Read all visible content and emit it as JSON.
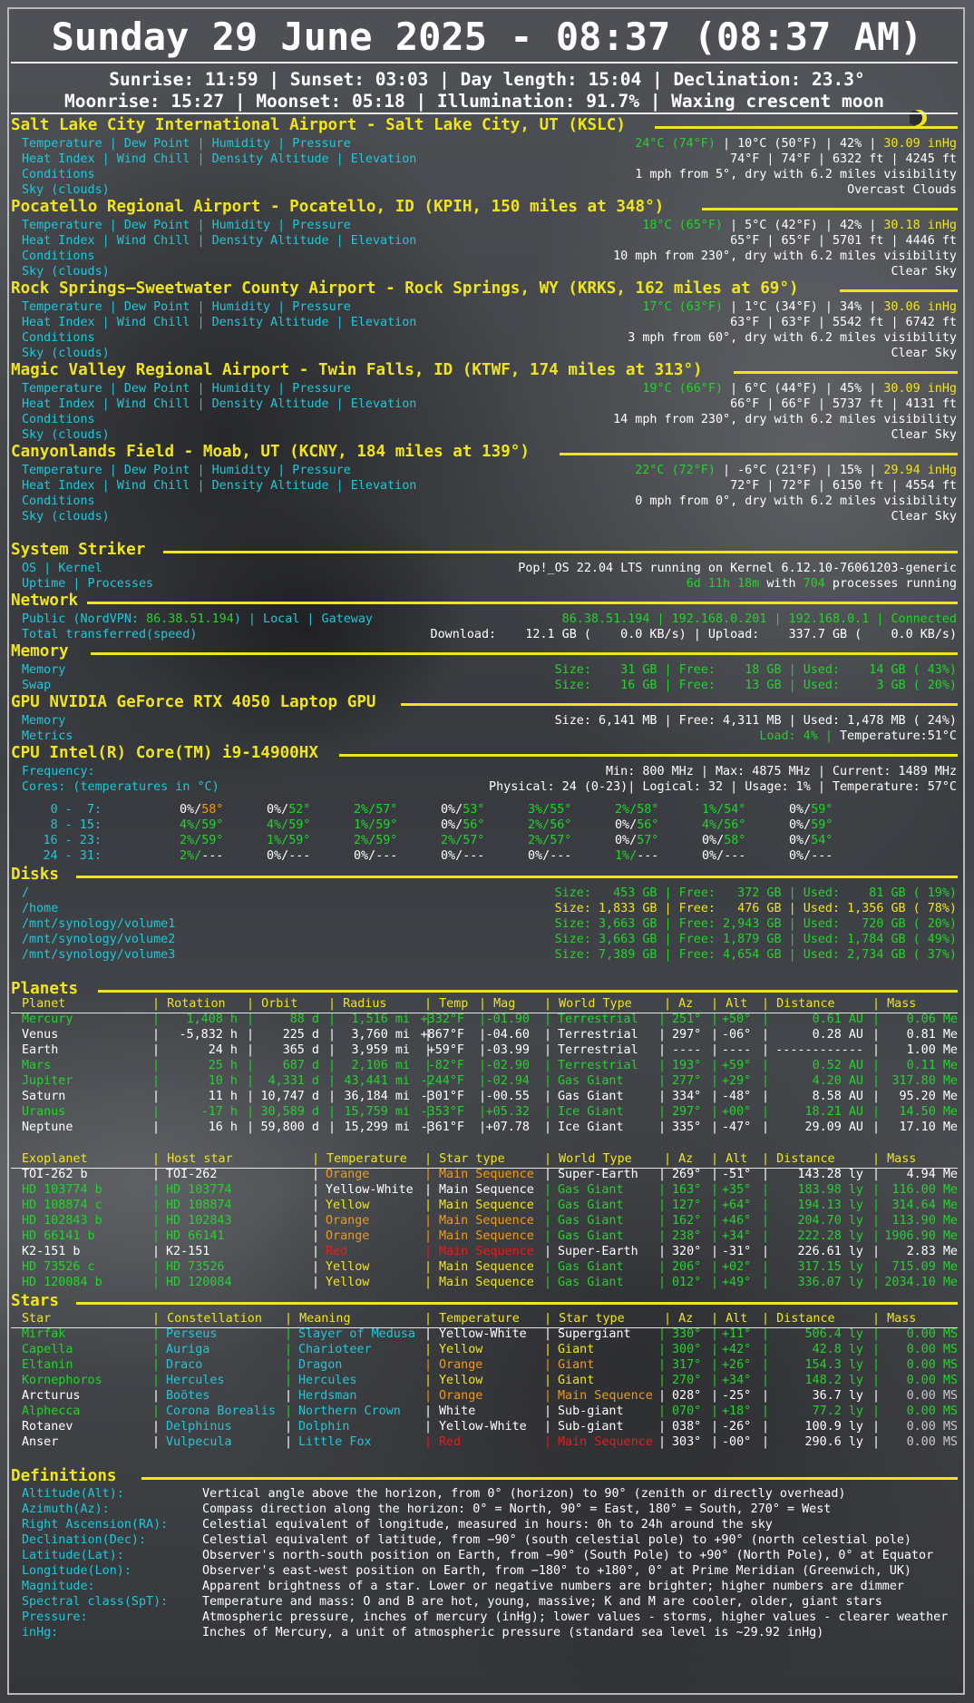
{
  "header": {
    "title": "Sunday 29 June 2025 - 08:37 (08:37 AM)",
    "sun_line": "Sunrise: 11:59 | Sunset: 03:03 | Day length: 15:04 | Declination: 23.3°",
    "moon_line": "Moonrise: 15:27 | Moonset: 05:18 | Illumination: 91.7% | Waxing crescent moon"
  },
  "labels": {
    "weather_row1": "Temperature | Dew Point | Humidity | Pressure",
    "weather_row2": "Heat Index | Wind Chill | Density Altitude | Elevation",
    "weather_row3": "Conditions",
    "weather_row4": "Sky (clouds)"
  },
  "stations": [
    {
      "title": "Salt Lake City International Airport - Salt Lake City, UT (KSLC)",
      "temp": "24°C (74°F)",
      "mid": " | 10°C (50°F) | 42% | ",
      "pressure": "30.09 inHg",
      "row2": "74°F | 74°F | 6322 ft | 4245 ft",
      "row3": "1 mph from 5°, dry with 6.2 miles visibility",
      "row4": "Overcast Clouds"
    },
    {
      "title": "Pocatello Regional Airport - Pocatello, ID (KPIH, 150 miles at 348°)",
      "temp": "18°C (65°F)",
      "mid": " | 5°C (42°F) | 42% | ",
      "pressure": "30.18 inHg",
      "row2": "65°F | 65°F | 5701 ft | 4446 ft",
      "row3": "10 mph from 230°, dry with 6.2 miles visibility",
      "row4": "Clear Sky"
    },
    {
      "title": "Rock Springs–Sweetwater County Airport - Rock Springs, WY (KRKS, 162 miles at 69°)",
      "temp": "17°C (63°F)",
      "mid": " | 1°C (34°F) | 34% | ",
      "pressure": "30.06 inHg",
      "row2": "63°F | 63°F | 5542 ft | 6742 ft",
      "row3": "3 mph from 60°, dry with 6.2 miles visibility",
      "row4": "Clear Sky"
    },
    {
      "title": "Magic Valley Regional Airport - Twin Falls, ID (KTWF, 174 miles at 313°)",
      "temp": "19°C (66°F)",
      "mid": " | 6°C (44°F) | 45% | ",
      "pressure": "30.09 inHg",
      "row2": "66°F | 66°F | 5737 ft | 4131 ft",
      "row3": "14 mph from 230°, dry with 6.2 miles visibility",
      "row4": "Clear Sky"
    },
    {
      "title": "Canyonlands Field - Moab, UT (KCNY, 184 miles at 139°)",
      "temp": "22°C (72°F)",
      "mid": " | -6°C (21°F) | 15% | ",
      "pressure": "29.94 inHg",
      "row2": "72°F | 72°F | 6150 ft | 4554 ft",
      "row3": "0 mph from 0°, dry with 6.2 miles visibility",
      "row4": "Clear Sky"
    }
  ],
  "system": {
    "title": "System Striker",
    "os_label": "OS | Kernel",
    "os_value": "Pop!_OS 22.04 LTS running on Kernel 6.12.10-76061203-generic",
    "uptime_label": "Uptime | Processes",
    "uptime_value": "6d 11h 18m",
    "uptime_mid": " with ",
    "processes": "704",
    "processes_suffix": " processes running"
  },
  "network": {
    "title": "Network",
    "public_label_a": "Public (NordVPN: ",
    "public_ip": "86.38.51.194",
    "public_label_b": ") | Local | Gateway",
    "public_value": "86.38.51.194 | 192.168.0.201 | 192.168.0.1 | Connected",
    "total_label": "Total transferred(speed)",
    "total_value": "Download:    12.1 GB (    0.0 KB/s) | Upload:    337.7 GB (    0.0 KB/s)"
  },
  "memory": {
    "title": "Memory",
    "mem_label": "Memory",
    "mem_value": "Size:    31 GB | Free:    18 GB | Used:    14 GB ( 43%)",
    "swap_label": "Swap",
    "swap_value": "Size:    16 GB | Free:    13 GB | Used:     3 GB ( 20%)"
  },
  "gpu": {
    "title": "GPU NVIDIA GeForce RTX 4050 Laptop GPU",
    "mem_label": "Memory",
    "mem_value": "Size: 6,141 MB | Free: 4,311 MB | Used: 1,478 MB ( 24%)",
    "metrics_label": "Metrics",
    "load": "Load: 4%",
    "load_sep": " | ",
    "temperature": "Temperature:51°C"
  },
  "cpu": {
    "title": "CPU Intel(R) Core(TM) i9-14900HX",
    "freq_label": "Frequency:",
    "freq_value": "Min: 800 MHz | Max: 4875 MHz | Current: 1489 MHz",
    "cores_label": "Cores: (temperatures in °C)",
    "cores_value": "Physical: 24 (0-23)| Logical: 32 | Usage: 1% | Temperature: 57°C",
    "rows": [
      {
        "label": "0 -  7:",
        "cells": [
          [
            "0%/",
            "58°",
            "w",
            "o"
          ],
          [
            "0%/",
            "52°",
            "w",
            "g"
          ],
          [
            "2%/",
            "57°",
            "g",
            "g"
          ],
          [
            "0%/",
            "53°",
            "w",
            "g"
          ],
          [
            "3%/",
            "55°",
            "g",
            "g"
          ],
          [
            "2%/",
            "58°",
            "g",
            "g"
          ],
          [
            "1%/",
            "54°",
            "g",
            "g"
          ],
          [
            "0%/",
            "59°",
            "w",
            "g"
          ]
        ]
      },
      {
        "label": "8 - 15:",
        "cells": [
          [
            "4%/",
            "59°",
            "g",
            "g"
          ],
          [
            "4%/",
            "59°",
            "g",
            "g"
          ],
          [
            "1%/",
            "59°",
            "g",
            "g"
          ],
          [
            "0%/",
            "56°",
            "w",
            "g"
          ],
          [
            "2%/",
            "56°",
            "g",
            "g"
          ],
          [
            "0%/",
            "56°",
            "w",
            "g"
          ],
          [
            "4%/",
            "56°",
            "g",
            "g"
          ],
          [
            "0%/",
            "59°",
            "w",
            "g"
          ]
        ]
      },
      {
        "label": "16 - 23:",
        "cells": [
          [
            "2%/",
            "59°",
            "g",
            "g"
          ],
          [
            "1%/",
            "59°",
            "g",
            "g"
          ],
          [
            "2%/",
            "59°",
            "g",
            "g"
          ],
          [
            "2%/",
            "57°",
            "g",
            "g"
          ],
          [
            "2%/",
            "57°",
            "g",
            "g"
          ],
          [
            "0%/",
            "57°",
            "w",
            "g"
          ],
          [
            "0%/",
            "58°",
            "w",
            "g"
          ],
          [
            "0%/",
            "54°",
            "w",
            "g"
          ]
        ]
      },
      {
        "label": "24 - 31:",
        "cells": [
          [
            "2%/",
            "---",
            "g",
            "w"
          ],
          [
            "0%/",
            "---",
            "w",
            "w"
          ],
          [
            "0%/",
            "---",
            "w",
            "w"
          ],
          [
            "0%/",
            "---",
            "w",
            "w"
          ],
          [
            "0%/",
            "---",
            "w",
            "w"
          ],
          [
            "1%/",
            "---",
            "g",
            "w"
          ],
          [
            "0%/",
            "---",
            "w",
            "w"
          ],
          [
            "0%/",
            "---",
            "w",
            "w"
          ]
        ]
      }
    ]
  },
  "disks": {
    "title": "Disks",
    "items": [
      {
        "mount": "/",
        "value": "Size:   453 GB | Free:   372 GB | Used:    81 GB ( 19%)",
        "cls": "g"
      },
      {
        "mount": "/home",
        "value": "Size: 1,833 GB | Free:   476 GB | Used: 1,356 GB ( 78%)",
        "cls": "y"
      },
      {
        "mount": "/mnt/synology/volume1",
        "value": "Size: 3,663 GB | Free: 2,943 GB | Used:   720 GB ( 20%)",
        "cls": "g"
      },
      {
        "mount": "/mnt/synology/volume2",
        "value": "Size: 3,663 GB | Free: 1,879 GB | Used: 1,784 GB ( 49%)",
        "cls": "g"
      },
      {
        "mount": "/mnt/synology/volume3",
        "value": "Size: 7,389 GB | Free: 4,654 GB | Used: 2,734 GB ( 37%)",
        "cls": "g"
      }
    ]
  },
  "planets": {
    "title": "Planets",
    "headers": [
      "Planet",
      "| Rotation",
      "| Orbit",
      "| Radius",
      "| Temp",
      "| Mag",
      "| World Type",
      "| Az",
      "| Alt",
      "| Distance",
      "| Mass"
    ],
    "rows": [
      {
        "c": "g",
        "name": "Mercury",
        "rot": "1,408 h",
        "orbit": "88 d",
        "radius": "1,516 mi",
        "temp": "+332°F",
        "mag": "-01.90",
        "type": "Terrestrial",
        "az": "251°",
        "alt": "+50°",
        "dist": "0.61 AU",
        "mass": "0.06 Me"
      },
      {
        "c": "w",
        "name": "Venus",
        "rot": "-5,832 h",
        "orbit": "225 d",
        "radius": "3,760 mi",
        "temp": "+867°F",
        "mag": "-04.60",
        "type": "Terrestrial",
        "az": "297°",
        "alt": "-06°",
        "dist": "0.28 AU",
        "mass": "0.81 Me"
      },
      {
        "c": "w",
        "name": "Earth",
        "rot": "24 h",
        "orbit": "365 d",
        "radius": "3,959 mi",
        "temp": "+59°F",
        "mag": "-03.99",
        "type": "Terrestrial",
        "az": "----",
        "alt": "----",
        "dist": "------------",
        "mass": "1.00 Me"
      },
      {
        "c": "g",
        "name": "Mars",
        "rot": "25 h",
        "orbit": "687 d",
        "radius": "2,106 mi",
        "temp": "-82°F",
        "mag": "-02.90",
        "type": "Terrestrial",
        "az": "193°",
        "alt": "+59°",
        "dist": "0.52 AU",
        "mass": "0.11 Me"
      },
      {
        "c": "g",
        "name": "Jupiter",
        "rot": "10 h",
        "orbit": "4,331 d",
        "radius": "43,441 mi",
        "temp": "-244°F",
        "mag": "-02.94",
        "type": "Gas Giant",
        "az": "277°",
        "alt": "+29°",
        "dist": "4.20 AU",
        "mass": "317.80 Me"
      },
      {
        "c": "w",
        "name": "Saturn",
        "rot": "11 h",
        "orbit": "10,747 d",
        "radius": "36,184 mi",
        "temp": "-301°F",
        "mag": "-00.55",
        "type": "Gas Giant",
        "az": "334°",
        "alt": "-48°",
        "dist": "8.58 AU",
        "mass": "95.20 Me"
      },
      {
        "c": "g",
        "name": "Uranus",
        "rot": "-17 h",
        "orbit": "30,589 d",
        "radius": "15,759 mi",
        "temp": "-353°F",
        "mag": "+05.32",
        "type": "Ice Giant",
        "az": "297°",
        "alt": "+00°",
        "dist": "18.21 AU",
        "mass": "14.50 Me"
      },
      {
        "c": "w",
        "name": "Neptune",
        "rot": "16 h",
        "orbit": "59,800 d",
        "radius": "15,299 mi",
        "temp": "-361°F",
        "mag": "+07.78",
        "type": "Ice Giant",
        "az": "335°",
        "alt": "-47°",
        "dist": "29.09 AU",
        "mass": "17.10 Me"
      }
    ]
  },
  "exoplanets": {
    "headers": [
      "Exoplanet",
      "| Host star",
      "| Temperature",
      "| Star type",
      "| World Type",
      "| Az",
      "| Alt",
      "| Distance",
      "| Mass"
    ],
    "rows": [
      {
        "c": "w",
        "name": "TOI-262 b",
        "host": "TOI-262",
        "temp": "Orange",
        "tc": "o",
        "stype": "Main Sequence",
        "sc": "o",
        "wtype": "Super-Earth",
        "az": "269°",
        "alt": "-51°",
        "dist": "143.28 ly",
        "mass": "4.94 Me"
      },
      {
        "c": "g",
        "name": "HD 103774 b",
        "host": "HD 103774",
        "temp": "Yellow-White",
        "tc": "w",
        "stype": "Main Sequence",
        "sc": "w",
        "wtype": "Gas Giant",
        "az": "163°",
        "alt": "+35°",
        "dist": "183.98 ly",
        "mass": "116.00 Me"
      },
      {
        "c": "g",
        "name": "HD 108874 c",
        "host": "HD 108874",
        "temp": "Yellow",
        "tc": "y",
        "stype": "Main Sequence",
        "sc": "y",
        "wtype": "Gas Giant",
        "az": "127°",
        "alt": "+64°",
        "dist": "194.13 ly",
        "mass": "314.64 Me"
      },
      {
        "c": "g",
        "name": "HD 102843 b",
        "host": "HD 102843",
        "temp": "Orange",
        "tc": "o",
        "stype": "Main Sequence",
        "sc": "o",
        "wtype": "Gas Giant",
        "az": "162°",
        "alt": "+46°",
        "dist": "204.70 ly",
        "mass": "113.90 Me"
      },
      {
        "c": "g",
        "name": "HD 66141 b",
        "host": "HD 66141",
        "temp": "Orange",
        "tc": "o",
        "stype": "Main Sequence",
        "sc": "o",
        "wtype": "Gas Giant",
        "az": "238°",
        "alt": "+34°",
        "dist": "222.28 ly",
        "mass": "1906.90 Me"
      },
      {
        "c": "w",
        "name": "K2-151 b",
        "host": "K2-151",
        "temp": "Red",
        "tc": "r",
        "stype": "Main Sequence",
        "sc": "r",
        "wtype": "Super-Earth",
        "az": "320°",
        "alt": "-31°",
        "dist": "226.61 ly",
        "mass": "2.83 Me"
      },
      {
        "c": "g",
        "name": "HD 73526 c",
        "host": "HD 73526",
        "temp": "Yellow",
        "tc": "y",
        "stype": "Main Sequence",
        "sc": "y",
        "wtype": "Gas Giant",
        "az": "206°",
        "alt": "+02°",
        "dist": "317.15 ly",
        "mass": "715.09 Me"
      },
      {
        "c": "g",
        "name": "HD 120084 b",
        "host": "HD 120084",
        "temp": "Yellow",
        "tc": "y",
        "stype": "Main Sequence",
        "sc": "y",
        "wtype": "Gas Giant",
        "az": "012°",
        "alt": "+49°",
        "dist": "336.07 ly",
        "mass": "2034.10 Me"
      }
    ]
  },
  "stars": {
    "title": "Stars",
    "headers": [
      "Star",
      "| Constellation",
      "| Meaning",
      "| Temperature",
      "| Star type",
      "| Az",
      "| Alt",
      "| Distance",
      "| Mass"
    ],
    "rows": [
      {
        "c": "g",
        "name": "Mirfak",
        "con": "Perseus",
        "mean": "Slayer of Medusa",
        "temp": "Yellow-White",
        "tc": "w",
        "stype": "Supergiant",
        "sc": "w",
        "az": "330°",
        "alt": "+11°",
        "dist": "506.4 ly",
        "mass": "0.00 MS"
      },
      {
        "c": "g",
        "name": "Capella",
        "con": "Auriga",
        "mean": "Charioteer",
        "temp": "Yellow",
        "tc": "y",
        "stype": "Giant",
        "sc": "y",
        "az": "300°",
        "alt": "+42°",
        "dist": "42.8 ly",
        "mass": "0.00 MS"
      },
      {
        "c": "g",
        "name": "Eltanin",
        "con": "Draco",
        "mean": "Dragon",
        "temp": "Orange",
        "tc": "o",
        "stype": "Giant",
        "sc": "o",
        "az": "317°",
        "alt": "+26°",
        "dist": "154.3 ly",
        "mass": "0.00 MS"
      },
      {
        "c": "g",
        "name": "Kornephoros",
        "con": "Hercules",
        "mean": "Hercules",
        "temp": "Yellow",
        "tc": "y",
        "stype": "Giant",
        "sc": "y",
        "az": "270°",
        "alt": "+34°",
        "dist": "148.2 ly",
        "mass": "0.00 MS"
      },
      {
        "c": "w",
        "name": "Arcturus",
        "con": "Boötes",
        "mean": "Herdsman",
        "temp": "Orange",
        "tc": "o",
        "stype": "Main Sequence",
        "sc": "o",
        "az": "028°",
        "alt": "-25°",
        "dist": "36.7 ly",
        "mass": "0.00 MS"
      },
      {
        "c": "g",
        "name": "Alphecca",
        "con": "Corona Borealis",
        "mean": "Northern Crown",
        "temp": "White",
        "tc": "w",
        "stype": "Sub-giant",
        "sc": "w",
        "az": "070°",
        "alt": "+18°",
        "dist": "77.2 ly",
        "mass": "0.00 MS"
      },
      {
        "c": "w",
        "name": "Rotanev",
        "con": "Delphinus",
        "mean": "Dolphin",
        "temp": "Yellow-White",
        "tc": "w",
        "stype": "Sub-giant",
        "sc": "w",
        "az": "038°",
        "alt": "-26°",
        "dist": "100.9 ly",
        "mass": "0.00 MS"
      },
      {
        "c": "w",
        "name": "Anser",
        "con": "Vulpecula",
        "mean": "Little Fox",
        "temp": "Red",
        "tc": "r",
        "stype": "Main Sequence",
        "sc": "r",
        "az": "303°",
        "alt": "-00°",
        "dist": "290.6 ly",
        "mass": "0.00 MS"
      }
    ]
  },
  "definitions": {
    "title": "Definitions",
    "items": [
      {
        "term": "Altitude(Alt):",
        "desc": "Vertical angle above the horizon, from 0° (horizon) to 90° (zenith or directly overhead)"
      },
      {
        "term": "Azimuth(Az):",
        "desc": "Compass direction along the horizon: 0° = North, 90° = East, 180° = South, 270° = West"
      },
      {
        "term": "Right Ascension(RA):",
        "desc": "Celestial equivalent of longitude, measured in hours: 0h to 24h around the sky"
      },
      {
        "term": "Declination(Dec):",
        "desc": "Celestial equivalent of latitude, from −90° (south celestial pole) to +90° (north celestial pole)"
      },
      {
        "term": "Latitude(Lat):",
        "desc": "Observer's north-south position on Earth, from −90° (South Pole) to +90° (North Pole), 0° at Equator"
      },
      {
        "term": "Longitude(Lon):",
        "desc": "Observer's east-west position on Earth, from −180° to +180°, 0° at Prime Meridian (Greenwich, UK)"
      },
      {
        "term": "Magnitude:",
        "desc": "Apparent brightness of a star. Lower or negative numbers are brighter; higher numbers are dimmer"
      },
      {
        "term": "Spectral class(SpT):",
        "desc": "Temperature and mass: O and B are hot, young, massive; K and M are cooler, older, giant stars"
      },
      {
        "term": "Pressure:",
        "desc": "Atmospheric pressure, inches of mercury (inHg); lower values - storms, higher values - clearer weather"
      },
      {
        "term": "inHg:",
        "desc": "Inches of Mercury, a unit of atmospheric pressure (standard sea level is ~29.92 inHg)"
      }
    ]
  },
  "colors": {
    "label": "#1ec8d8",
    "value": "#ffffff",
    "good": "#22d42a",
    "warn": "#f0e51c",
    "orange": "#f09a18",
    "red": "#f01818"
  }
}
